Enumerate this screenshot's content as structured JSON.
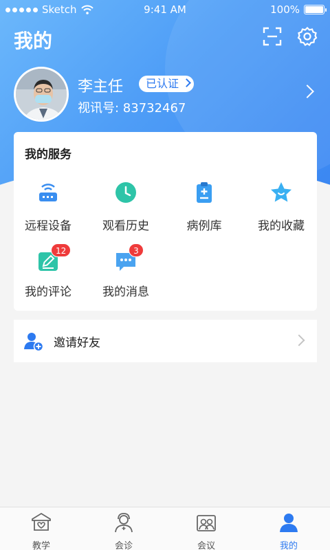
{
  "status_bar": {
    "carrier": "Sketch",
    "time": "9:41 AM",
    "battery": "100%"
  },
  "header": {
    "title": "我的",
    "scan_icon": "scan-icon",
    "settings_icon": "gear-icon"
  },
  "profile": {
    "name": "李主任",
    "verified_label": "已认证",
    "video_id": "视讯号: 83732467"
  },
  "services": {
    "title": "我的服务",
    "items": [
      {
        "label": "远程设备",
        "icon": "router-icon",
        "color": "#3a8ef0"
      },
      {
        "label": "观看历史",
        "icon": "clock-icon",
        "color": "#2ec4a8"
      },
      {
        "label": "病例库",
        "icon": "clipboard-icon",
        "color": "#3a9ef2"
      },
      {
        "label": "我的收藏",
        "icon": "star-icon",
        "color": "#3ab0f2"
      },
      {
        "label": "我的评论",
        "icon": "edit-icon",
        "color": "#2ec4a8",
        "badge": "12"
      },
      {
        "label": "我的消息",
        "icon": "message-icon",
        "color": "#4aa3f0",
        "badge": "3"
      }
    ]
  },
  "invite": {
    "label": "邀请好友",
    "icon": "add-user-icon"
  },
  "tabbar": {
    "tabs": [
      {
        "label": "教学",
        "icon": "teaching-icon"
      },
      {
        "label": "会诊",
        "icon": "consultation-icon"
      },
      {
        "label": "会议",
        "icon": "meeting-icon"
      },
      {
        "label": "我的",
        "icon": "profile-icon",
        "active": true
      }
    ]
  },
  "colors": {
    "primary": "#2d7af0",
    "hero_start": "#6cb8fb",
    "hero_end": "#3a86f2",
    "badge": "#ef3b3b"
  }
}
